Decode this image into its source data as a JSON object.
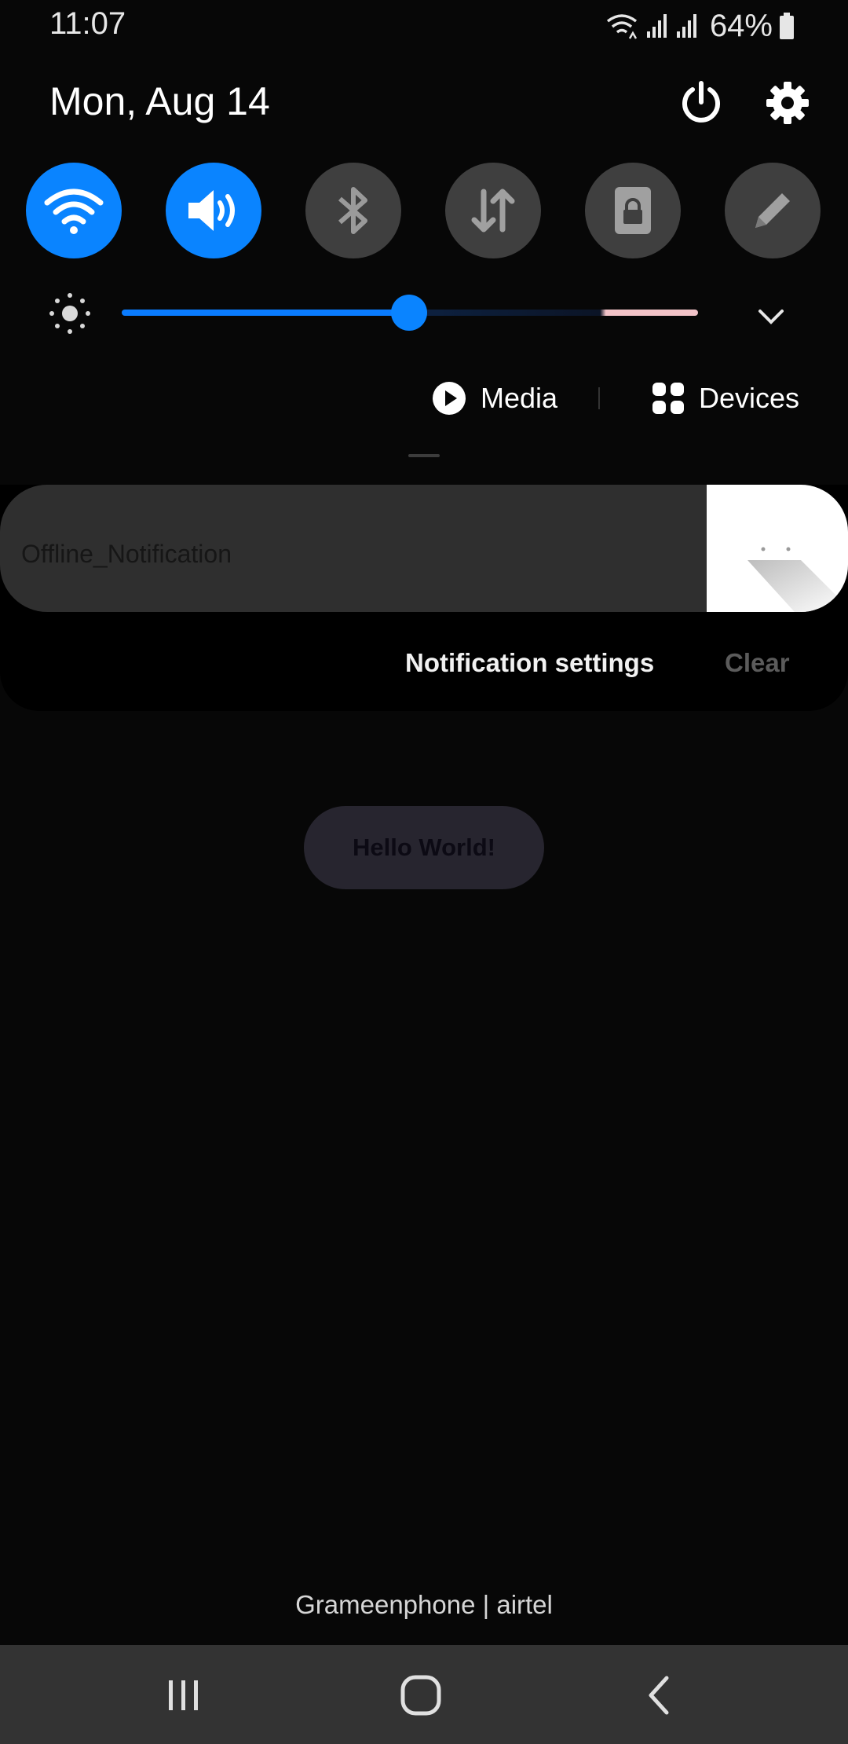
{
  "status_bar": {
    "time": "11:07",
    "battery_percent": "64%",
    "icons": [
      "wifi-data-icon",
      "signal-icon",
      "signal-icon",
      "battery-icon"
    ]
  },
  "header": {
    "date": "Mon, Aug 14",
    "power_icon": "power-icon",
    "settings_icon": "gear-icon"
  },
  "quick_tiles": [
    {
      "name": "wifi",
      "icon": "wifi-icon",
      "active": true
    },
    {
      "name": "sound",
      "icon": "speaker-icon",
      "active": true
    },
    {
      "name": "bluetooth",
      "icon": "bluetooth-icon",
      "active": false
    },
    {
      "name": "mobile-data",
      "icon": "data-arrows-icon",
      "active": false
    },
    {
      "name": "lock-screen",
      "icon": "lock-icon",
      "active": false
    },
    {
      "name": "edit",
      "icon": "pencil-icon",
      "active": false
    }
  ],
  "brightness": {
    "level": 0.5
  },
  "media_devices": {
    "media_label": "Media",
    "devices_label": "Devices"
  },
  "notification": {
    "title": "Offline_Notification",
    "settings_label": "Notification settings",
    "clear_label": "Clear"
  },
  "app": {
    "button_label": "Hello World!"
  },
  "carrier": "Grameenphone | airtel",
  "colors": {
    "accent": "#0a84ff",
    "tile_off": "#3f3f3f",
    "background": "#070707",
    "navbar": "#333333"
  }
}
